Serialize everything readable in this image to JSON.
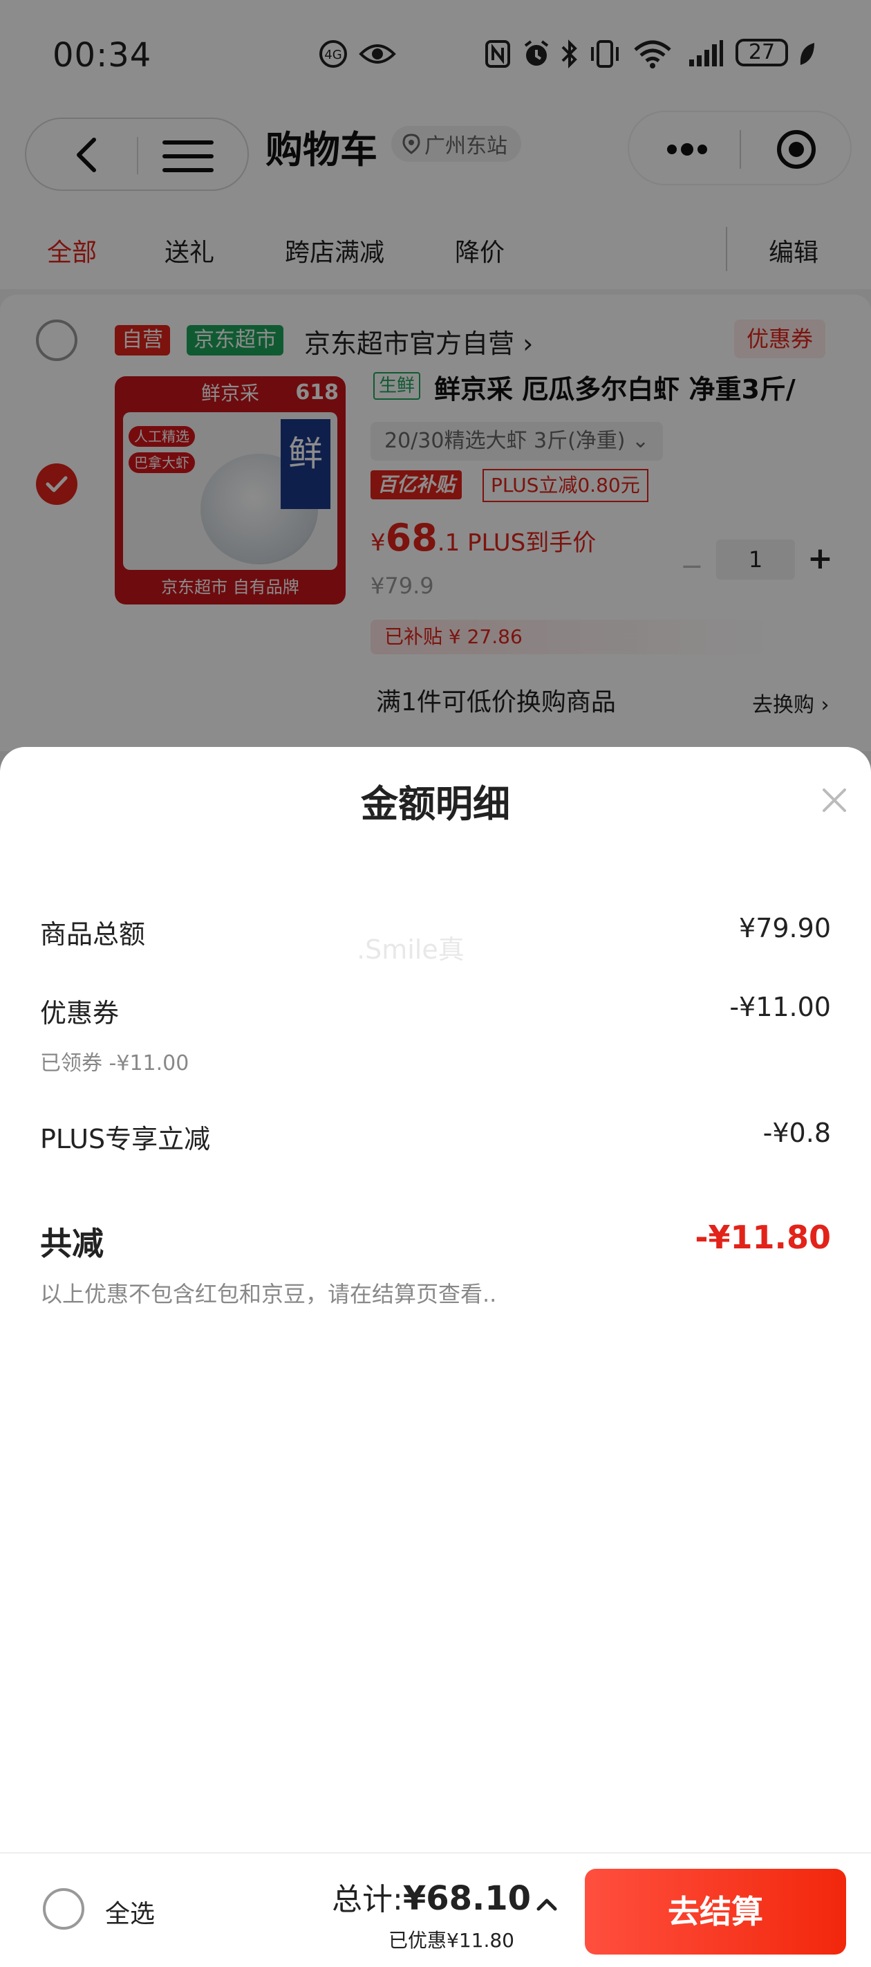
{
  "status_bar": {
    "time": "00:34",
    "battery": "27"
  },
  "header": {
    "title": "购物车",
    "location": "广州东站"
  },
  "tabs": [
    {
      "label": "全部",
      "active": true
    },
    {
      "label": "送礼"
    },
    {
      "label": "跨店满减"
    },
    {
      "label": "降价"
    }
  ],
  "tab_action": "编辑",
  "store": {
    "self_tag": "自营",
    "jd_tag": "京东超市",
    "name": "京东超市官方自营 ›",
    "coupon": "优惠券"
  },
  "product": {
    "image": {
      "brand": "鲜京采",
      "badge": "618",
      "tag1": "人工精选",
      "tag2": "巴拿大虾",
      "char": "鲜",
      "footer": "京东超市 自有品牌"
    },
    "fresh_tag": "生鲜",
    "title": "鲜京采 厄瓜多尔白虾 净重3斤/",
    "spec": "20/30精选大虾 3斤(净重)  ⌄",
    "subsidy_logo": "百亿补贴",
    "plus_tag": "PLUS立减0.80元",
    "price_symbol": "¥",
    "price_int": "68",
    "price_rest": ".1 PLUS到手价",
    "original_price": "¥79.9",
    "subsidy_amount": "已补贴 ¥ 27.86",
    "quantity": "1",
    "minus": "−",
    "plus": "+"
  },
  "swap": {
    "text": "满1件可低价换购商品",
    "link": "去换购 ›"
  },
  "sheet": {
    "title": "金额明细",
    "watermark": ".Smile真",
    "goods_total_label": "商品总额",
    "goods_total_value": "¥79.90",
    "coupon_label": "优惠券",
    "coupon_value": "-¥11.00",
    "coupon_sub": "已领券 -¥11.00",
    "plus_label": "PLUS专享立减",
    "plus_value": "-¥0.8",
    "total_label": "共减",
    "total_value": "-¥11.80",
    "note": "以上优惠不包含红包和京豆，请在结算页查看.."
  },
  "bottom": {
    "select_all": "全选",
    "sum_prefix": "总计:",
    "sum_amount": "¥68.10",
    "saved": "已优惠¥11.80",
    "checkout": "去结算"
  },
  "colors": {
    "accent": "#e2231a",
    "jd_green": "#1ea55b"
  }
}
